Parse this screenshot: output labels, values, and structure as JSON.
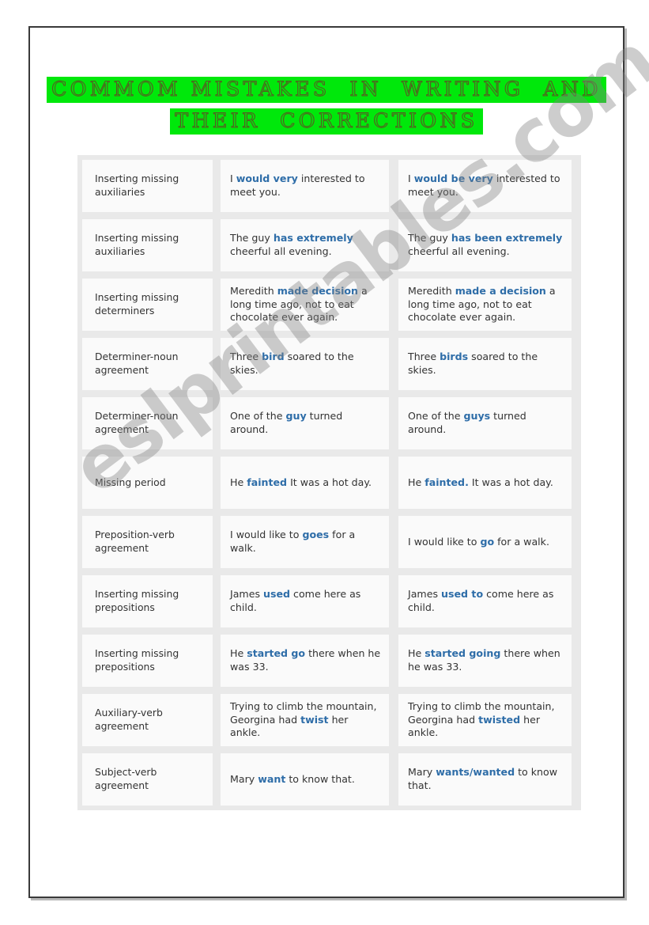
{
  "title": {
    "line1": "COMMOM MISTAKES  IN  WRITING  AND",
    "line2": "THEIR  CORRECTIONS",
    "highlight_color": "#00e80b",
    "text_outline_color": "#5c6124"
  },
  "watermark": {
    "text": "eslprintables.com",
    "color": "#828282"
  },
  "colors": {
    "highlight_blue": "#2e6da8",
    "cell_background": "#fafafa",
    "table_background": "#e9e9e9",
    "body_text": "#333333",
    "page_border": "#3a3a3a"
  },
  "table": {
    "rows": [
      {
        "category": "Inserting missing auxiliaries",
        "mistake": [
          {
            "t": "I ",
            "hl": false
          },
          {
            "t": "would very",
            "hl": true
          },
          {
            "t": " interested to meet you.",
            "hl": false
          }
        ],
        "correction": [
          {
            "t": "I ",
            "hl": false
          },
          {
            "t": "would be very",
            "hl": true
          },
          {
            "t": " interested to meet you.",
            "hl": false
          }
        ]
      },
      {
        "category": "Inserting missing auxiliaries",
        "mistake": [
          {
            "t": "The guy ",
            "hl": false
          },
          {
            "t": "has extremely",
            "hl": true
          },
          {
            "t": " cheerful all evening.",
            "hl": false
          }
        ],
        "correction": [
          {
            "t": "The guy ",
            "hl": false
          },
          {
            "t": "has been extremely",
            "hl": true
          },
          {
            "t": " cheerful all evening.",
            "hl": false
          }
        ]
      },
      {
        "category": "Inserting missing determiners",
        "mistake": [
          {
            "t": "Meredith ",
            "hl": false
          },
          {
            "t": "made decision",
            "hl": true
          },
          {
            "t": " a long time ago, not to eat chocolate ever again.",
            "hl": false
          }
        ],
        "correction": [
          {
            "t": "Meredith ",
            "hl": false
          },
          {
            "t": "made a decision",
            "hl": true
          },
          {
            "t": " a long time ago, not to eat chocolate ever again.",
            "hl": false
          }
        ]
      },
      {
        "category": "Determiner-noun agreement",
        "mistake": [
          {
            "t": "Three ",
            "hl": false
          },
          {
            "t": "bird",
            "hl": true
          },
          {
            "t": " soared to the skies.",
            "hl": false
          }
        ],
        "correction": [
          {
            "t": "Three ",
            "hl": false
          },
          {
            "t": "birds",
            "hl": true
          },
          {
            "t": " soared to the skies.",
            "hl": false
          }
        ]
      },
      {
        "category": "Determiner-noun agreement",
        "mistake": [
          {
            "t": "One of the ",
            "hl": false
          },
          {
            "t": "guy",
            "hl": true
          },
          {
            "t": " turned around.",
            "hl": false
          }
        ],
        "correction": [
          {
            "t": "One of the ",
            "hl": false
          },
          {
            "t": "guys",
            "hl": true
          },
          {
            "t": " turned around.",
            "hl": false
          }
        ]
      },
      {
        "category": "Missing period",
        "mistake": [
          {
            "t": "He ",
            "hl": false
          },
          {
            "t": "fainted",
            "hl": true
          },
          {
            "t": " It was a hot day.",
            "hl": false
          }
        ],
        "correction": [
          {
            "t": "He ",
            "hl": false
          },
          {
            "t": "fainted.",
            "hl": true
          },
          {
            "t": " It was a hot day.",
            "hl": false
          }
        ]
      },
      {
        "category": "Preposition-verb agreement",
        "mistake": [
          {
            "t": "I would like to ",
            "hl": false
          },
          {
            "t": "goes",
            "hl": true
          },
          {
            "t": " for a walk.",
            "hl": false
          }
        ],
        "correction": [
          {
            "t": "I would like to ",
            "hl": false
          },
          {
            "t": "go",
            "hl": true
          },
          {
            "t": " for a walk.",
            "hl": false
          }
        ]
      },
      {
        "category": "Inserting missing prepositions",
        "mistake": [
          {
            "t": "James ",
            "hl": false
          },
          {
            "t": "used",
            "hl": true
          },
          {
            "t": " come here as child.",
            "hl": false
          }
        ],
        "correction": [
          {
            "t": "James ",
            "hl": false
          },
          {
            "t": "used to",
            "hl": true
          },
          {
            "t": " come here as child.",
            "hl": false
          }
        ]
      },
      {
        "category": "Inserting missing prepositions",
        "mistake": [
          {
            "t": "He ",
            "hl": false
          },
          {
            "t": "started go",
            "hl": true
          },
          {
            "t": " there when he was 33.",
            "hl": false
          }
        ],
        "correction": [
          {
            "t": "He ",
            "hl": false
          },
          {
            "t": "started going",
            "hl": true
          },
          {
            "t": " there when he was 33.",
            "hl": false
          }
        ]
      },
      {
        "category": "Auxiliary-verb agreement",
        "mistake": [
          {
            "t": "Trying to climb the mountain, Georgina had ",
            "hl": false
          },
          {
            "t": "twist",
            "hl": true
          },
          {
            "t": " her ankle.",
            "hl": false
          }
        ],
        "correction": [
          {
            "t": "Trying to climb the mountain, Georgina had ",
            "hl": false
          },
          {
            "t": "twisted",
            "hl": true
          },
          {
            "t": " her ankle.",
            "hl": false
          }
        ]
      },
      {
        "category": "Subject-verb agreement",
        "mistake": [
          {
            "t": "Mary ",
            "hl": false
          },
          {
            "t": "want",
            "hl": true
          },
          {
            "t": " to know that.",
            "hl": false
          }
        ],
        "correction": [
          {
            "t": "Mary ",
            "hl": false
          },
          {
            "t": "wants/wanted",
            "hl": true
          },
          {
            "t": " to know that.",
            "hl": false
          }
        ]
      }
    ]
  }
}
